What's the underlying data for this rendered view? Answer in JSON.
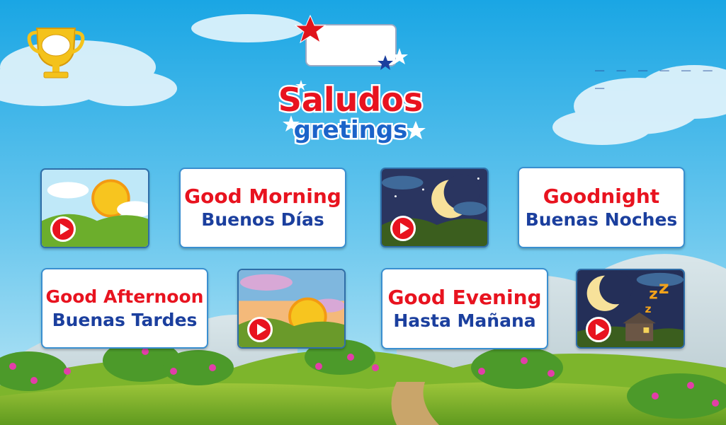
{
  "title": {
    "main": "Saludos",
    "sub": "gretings"
  },
  "score": {
    "value": ""
  },
  "word_blanks": "_ _ _ _ _ _ _",
  "colors": {
    "sky_top": "#1aa6e4",
    "sky_bottom": "#bfe8f6",
    "english_text": "#e8131f",
    "spanish_text": "#1b3f9e",
    "card_border": "#3a8fd0"
  },
  "icons": {
    "trophy": "trophy-icon",
    "play": "play-icon",
    "star": "star-icon"
  },
  "cards": [
    {
      "english": "Good Morning",
      "spanish": "Buenos Días"
    },
    {
      "english": "Goodnight",
      "spanish": "Buenas Noches"
    },
    {
      "english": "Good Afternoon",
      "spanish": "Buenas Tardes"
    },
    {
      "english": "Good Evening",
      "spanish": "Hasta Mañana"
    }
  ],
  "thumbnails": [
    {
      "scene": "morning-sun"
    },
    {
      "scene": "night-moon"
    },
    {
      "scene": "afternoon-sunset"
    },
    {
      "scene": "evening-sleeping-house"
    }
  ]
}
